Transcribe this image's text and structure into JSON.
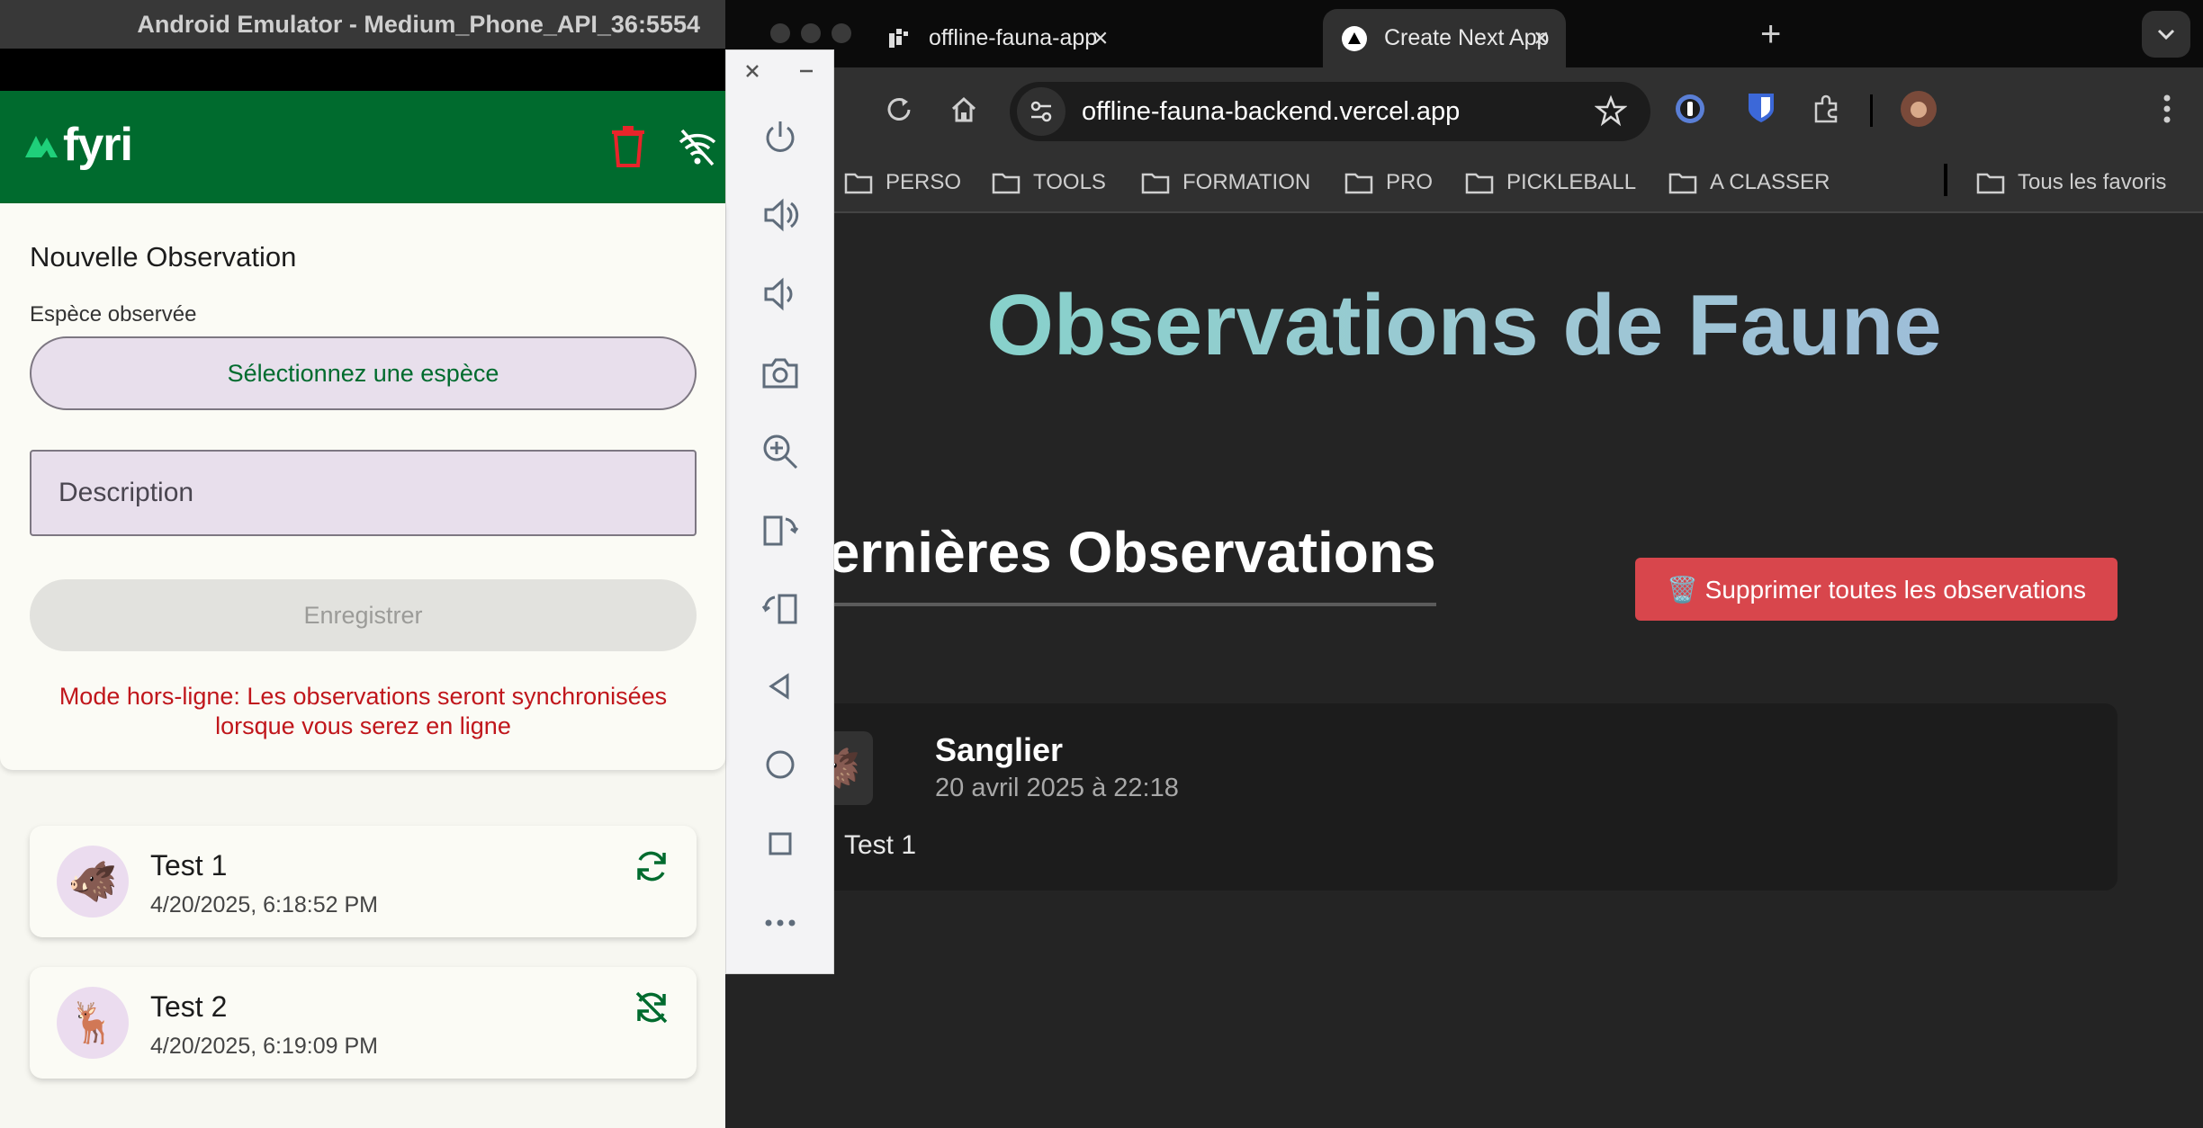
{
  "emulator": {
    "window_title": "Android Emulator - Medium_Phone_API_36:5554",
    "app": {
      "logo_text": "fyri",
      "form": {
        "title": "Nouvelle Observation",
        "species_label": "Espèce observée",
        "species_select_placeholder": "Sélectionnez une espèce",
        "description_placeholder": "Description",
        "save_label": "Enregistrer",
        "offline_message": "Mode hors-ligne: Les observations seront synchronisées lorsque vous serez en ligne"
      },
      "observations": [
        {
          "name": "Test 1",
          "date": "4/20/2025, 6:18:52 PM",
          "emoji": "🐗",
          "sync_icon": "sync-icon"
        },
        {
          "name": "Test 2",
          "date": "4/20/2025, 6:19:09 PM",
          "emoji": "🦌",
          "sync_icon": "sync-off-icon"
        }
      ],
      "colors": {
        "primary": "#006b2e",
        "error": "#c0161b",
        "input_bg": "#e8dfec"
      }
    }
  },
  "browser": {
    "tabs": [
      {
        "title": "offline-fauna-app--ncgcwtmh",
        "active": false
      },
      {
        "title": "Create Next App",
        "active": true
      }
    ],
    "url": "offline-fauna-backend.vercel.app",
    "bookmarks": [
      "PERSO",
      "TOOLS",
      "FORMATION",
      "PRO",
      "PICKLEBALL",
      "A CLASSER"
    ],
    "all_bookmarks": "Tous les favoris",
    "page": {
      "title": "Observations de Faune",
      "section_title": "📝 Dernières Observations",
      "delete_all_button": "🗑️ Supprimer toutes les observations",
      "observation": {
        "emoji": "🐗",
        "name": "Sanglier",
        "date": "20 avril 2025 à 22:18",
        "description": "Test 1"
      },
      "colors": {
        "delete_button": "#d8464c",
        "background": "#242424"
      }
    }
  }
}
